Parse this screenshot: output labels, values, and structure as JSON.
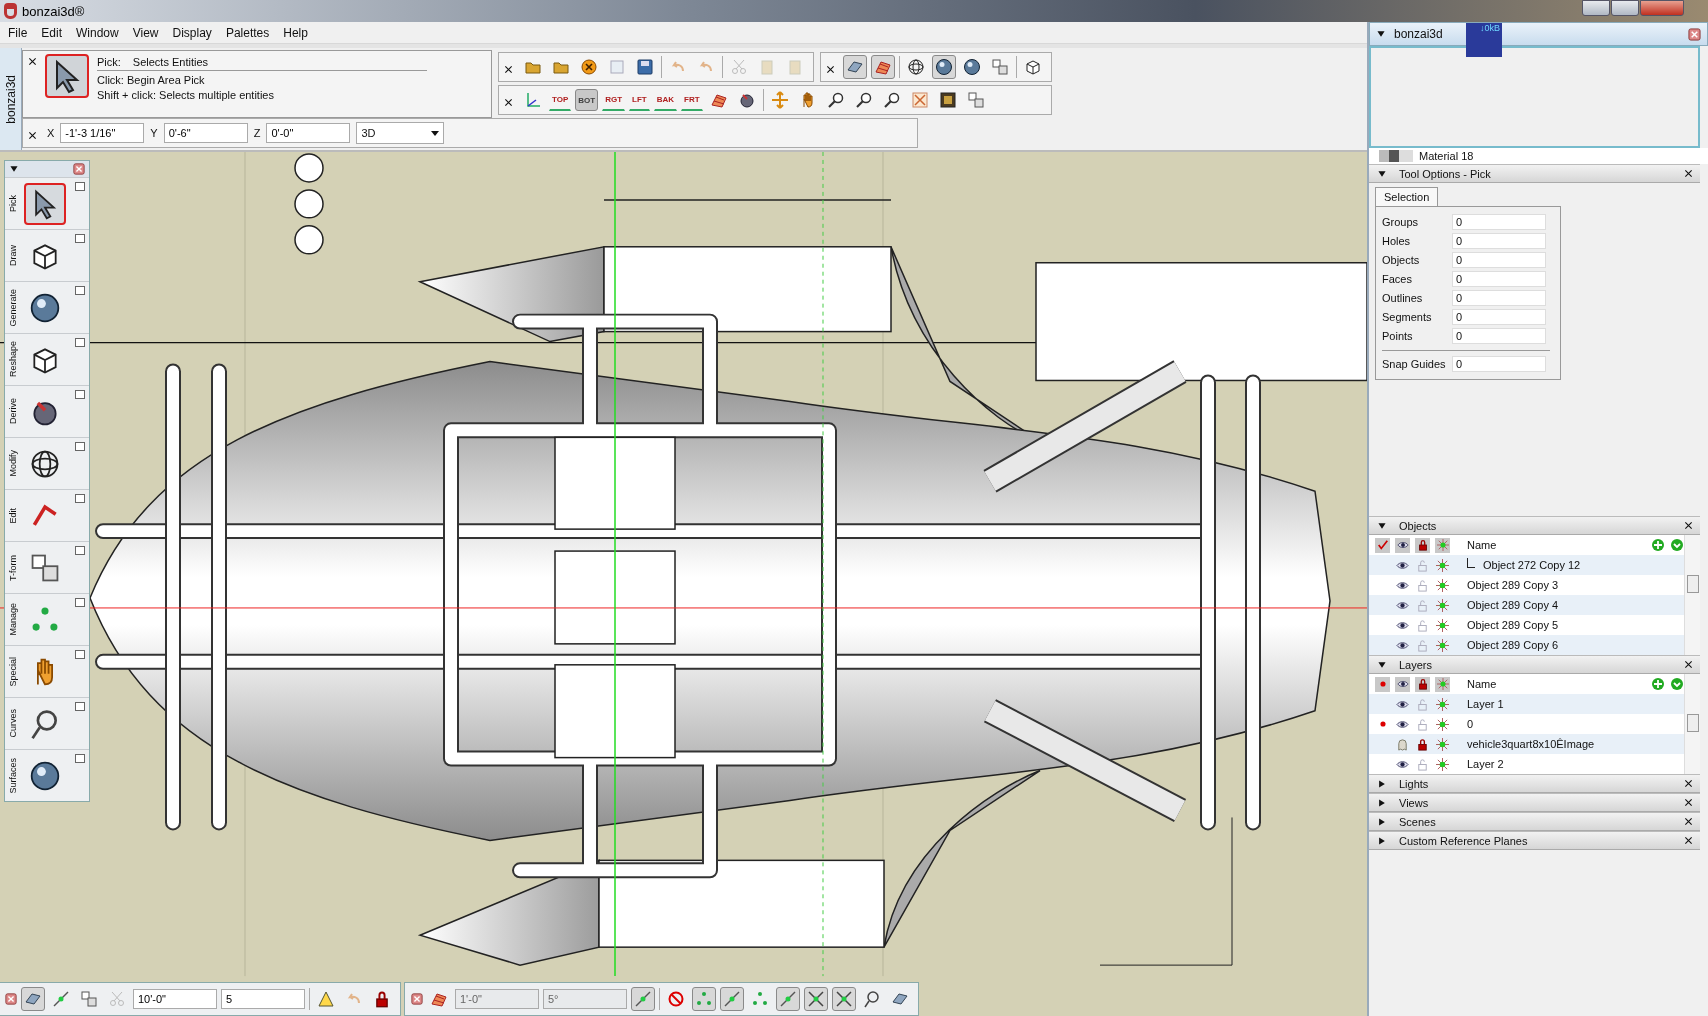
{
  "window": {
    "title": "bonzai3d®"
  },
  "menu": [
    "File",
    "Edit",
    "Window",
    "View",
    "Display",
    "Palettes",
    "Help"
  ],
  "side_tab": {
    "label": "bonzai3d"
  },
  "tool_hint": {
    "tool": "Pick:",
    "summary": "Selects Entities",
    "lines": [
      "Click: Begin Area Pick",
      "Shift + click: Selects multiple entities"
    ]
  },
  "view_buttons": [
    {
      "label": "TOP",
      "selected": false
    },
    {
      "label": "BOT",
      "selected": true
    },
    {
      "label": "RGT",
      "selected": false
    },
    {
      "label": "LFT",
      "selected": false
    },
    {
      "label": "BAK",
      "selected": false
    },
    {
      "label": "FRT",
      "selected": false
    }
  ],
  "coordinates": [
    {
      "axis": "X",
      "value": "-1'-3 1/16\""
    },
    {
      "axis": "Y",
      "value": "0'-6\""
    },
    {
      "axis": "Z",
      "value": "0'-0\""
    }
  ],
  "view_mode": "3D",
  "palette": [
    {
      "label": "Pick",
      "selected": true
    },
    {
      "label": "Draw",
      "selected": false
    },
    {
      "label": "Generate",
      "selected": false
    },
    {
      "label": "Reshape",
      "selected": false
    },
    {
      "label": "Derive",
      "selected": false
    },
    {
      "label": "Modify",
      "selected": false
    },
    {
      "label": "Edit",
      "selected": false
    },
    {
      "label": "T-form",
      "selected": false
    },
    {
      "label": "Manage",
      "selected": false
    },
    {
      "label": "Special",
      "selected": false
    },
    {
      "label": "Curves",
      "selected": false
    },
    {
      "label": "Surfaces",
      "selected": false
    }
  ],
  "snap_bar": {
    "fields": [
      "10'-0\"",
      "5"
    ]
  },
  "grid_bar": {
    "fields": [
      "1'-0\"",
      "5°"
    ]
  },
  "panel": {
    "title": "bonzai3d",
    "meter": "↓0kB",
    "material": "Material 18",
    "tool_options": {
      "title": "Tool Options - Pick",
      "tab": "Selection",
      "fields": [
        {
          "label": "Groups",
          "value": "0"
        },
        {
          "label": "Holes",
          "value": "0"
        },
        {
          "label": "Objects",
          "value": "0"
        },
        {
          "label": "Faces",
          "value": "0"
        },
        {
          "label": "Outlines",
          "value": "0"
        },
        {
          "label": "Segments",
          "value": "0"
        },
        {
          "label": "Points",
          "value": "0"
        },
        {
          "label": "Snap Guides",
          "value": "0"
        }
      ]
    },
    "objects": {
      "title": "Objects",
      "header": "Name",
      "rows": [
        {
          "name": "Object 272 Copy 12",
          "kind": "child",
          "visible": true,
          "locked": false
        },
        {
          "name": "Object 289 Copy 3",
          "kind": "item",
          "visible": true,
          "locked": false
        },
        {
          "name": "Object 289 Copy 4",
          "kind": "item",
          "visible": true,
          "locked": false
        },
        {
          "name": "Object 289 Copy 5",
          "kind": "item",
          "visible": true,
          "locked": false
        },
        {
          "name": "Object 289 Copy 6",
          "kind": "item",
          "visible": true,
          "locked": false
        }
      ]
    },
    "layers": {
      "title": "Layers",
      "header": "Name",
      "rows": [
        {
          "name": "Layer 1",
          "active": false,
          "visible": true,
          "locked": false
        },
        {
          "name": "0",
          "active": true,
          "visible": true,
          "locked": false
        },
        {
          "name": "vehicle3quart8x10ÊImage",
          "active": false,
          "visible": false,
          "locked": true
        },
        {
          "name": "Layer 2",
          "active": false,
          "visible": true,
          "locked": false
        }
      ]
    },
    "collapsed": [
      "Lights",
      "Views",
      "Scenes",
      "Custom Reference Planes"
    ]
  }
}
